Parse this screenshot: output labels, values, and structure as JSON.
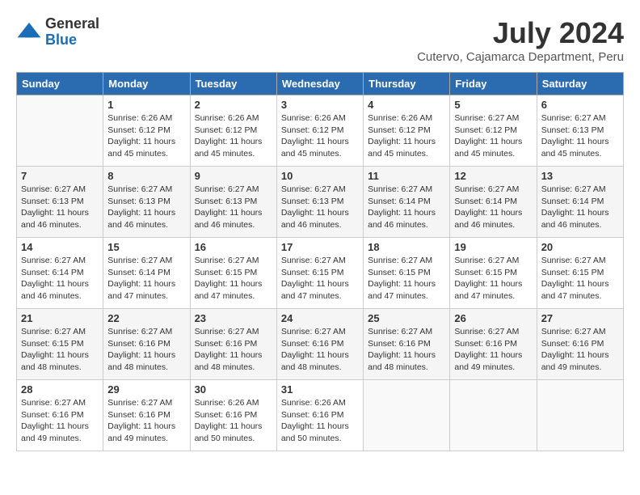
{
  "logo": {
    "general": "General",
    "blue": "Blue"
  },
  "title": {
    "month_year": "July 2024",
    "location": "Cutervo, Cajamarca Department, Peru"
  },
  "days_of_week": [
    "Sunday",
    "Monday",
    "Tuesday",
    "Wednesday",
    "Thursday",
    "Friday",
    "Saturday"
  ],
  "weeks": [
    [
      {
        "day": "",
        "info": ""
      },
      {
        "day": "1",
        "info": "Sunrise: 6:26 AM\nSunset: 6:12 PM\nDaylight: 11 hours and 45 minutes."
      },
      {
        "day": "2",
        "info": "Sunrise: 6:26 AM\nSunset: 6:12 PM\nDaylight: 11 hours and 45 minutes."
      },
      {
        "day": "3",
        "info": "Sunrise: 6:26 AM\nSunset: 6:12 PM\nDaylight: 11 hours and 45 minutes."
      },
      {
        "day": "4",
        "info": "Sunrise: 6:26 AM\nSunset: 6:12 PM\nDaylight: 11 hours and 45 minutes."
      },
      {
        "day": "5",
        "info": "Sunrise: 6:27 AM\nSunset: 6:12 PM\nDaylight: 11 hours and 45 minutes."
      },
      {
        "day": "6",
        "info": "Sunrise: 6:27 AM\nSunset: 6:13 PM\nDaylight: 11 hours and 45 minutes."
      }
    ],
    [
      {
        "day": "7",
        "info": "Sunrise: 6:27 AM\nSunset: 6:13 PM\nDaylight: 11 hours and 46 minutes."
      },
      {
        "day": "8",
        "info": "Sunrise: 6:27 AM\nSunset: 6:13 PM\nDaylight: 11 hours and 46 minutes."
      },
      {
        "day": "9",
        "info": "Sunrise: 6:27 AM\nSunset: 6:13 PM\nDaylight: 11 hours and 46 minutes."
      },
      {
        "day": "10",
        "info": "Sunrise: 6:27 AM\nSunset: 6:13 PM\nDaylight: 11 hours and 46 minutes."
      },
      {
        "day": "11",
        "info": "Sunrise: 6:27 AM\nSunset: 6:14 PM\nDaylight: 11 hours and 46 minutes."
      },
      {
        "day": "12",
        "info": "Sunrise: 6:27 AM\nSunset: 6:14 PM\nDaylight: 11 hours and 46 minutes."
      },
      {
        "day": "13",
        "info": "Sunrise: 6:27 AM\nSunset: 6:14 PM\nDaylight: 11 hours and 46 minutes."
      }
    ],
    [
      {
        "day": "14",
        "info": "Sunrise: 6:27 AM\nSunset: 6:14 PM\nDaylight: 11 hours and 46 minutes."
      },
      {
        "day": "15",
        "info": "Sunrise: 6:27 AM\nSunset: 6:14 PM\nDaylight: 11 hours and 47 minutes."
      },
      {
        "day": "16",
        "info": "Sunrise: 6:27 AM\nSunset: 6:15 PM\nDaylight: 11 hours and 47 minutes."
      },
      {
        "day": "17",
        "info": "Sunrise: 6:27 AM\nSunset: 6:15 PM\nDaylight: 11 hours and 47 minutes."
      },
      {
        "day": "18",
        "info": "Sunrise: 6:27 AM\nSunset: 6:15 PM\nDaylight: 11 hours and 47 minutes."
      },
      {
        "day": "19",
        "info": "Sunrise: 6:27 AM\nSunset: 6:15 PM\nDaylight: 11 hours and 47 minutes."
      },
      {
        "day": "20",
        "info": "Sunrise: 6:27 AM\nSunset: 6:15 PM\nDaylight: 11 hours and 47 minutes."
      }
    ],
    [
      {
        "day": "21",
        "info": "Sunrise: 6:27 AM\nSunset: 6:15 PM\nDaylight: 11 hours and 48 minutes."
      },
      {
        "day": "22",
        "info": "Sunrise: 6:27 AM\nSunset: 6:16 PM\nDaylight: 11 hours and 48 minutes."
      },
      {
        "day": "23",
        "info": "Sunrise: 6:27 AM\nSunset: 6:16 PM\nDaylight: 11 hours and 48 minutes."
      },
      {
        "day": "24",
        "info": "Sunrise: 6:27 AM\nSunset: 6:16 PM\nDaylight: 11 hours and 48 minutes."
      },
      {
        "day": "25",
        "info": "Sunrise: 6:27 AM\nSunset: 6:16 PM\nDaylight: 11 hours and 48 minutes."
      },
      {
        "day": "26",
        "info": "Sunrise: 6:27 AM\nSunset: 6:16 PM\nDaylight: 11 hours and 49 minutes."
      },
      {
        "day": "27",
        "info": "Sunrise: 6:27 AM\nSunset: 6:16 PM\nDaylight: 11 hours and 49 minutes."
      }
    ],
    [
      {
        "day": "28",
        "info": "Sunrise: 6:27 AM\nSunset: 6:16 PM\nDaylight: 11 hours and 49 minutes."
      },
      {
        "day": "29",
        "info": "Sunrise: 6:27 AM\nSunset: 6:16 PM\nDaylight: 11 hours and 49 minutes."
      },
      {
        "day": "30",
        "info": "Sunrise: 6:26 AM\nSunset: 6:16 PM\nDaylight: 11 hours and 50 minutes."
      },
      {
        "day": "31",
        "info": "Sunrise: 6:26 AM\nSunset: 6:16 PM\nDaylight: 11 hours and 50 minutes."
      },
      {
        "day": "",
        "info": ""
      },
      {
        "day": "",
        "info": ""
      },
      {
        "day": "",
        "info": ""
      }
    ]
  ]
}
